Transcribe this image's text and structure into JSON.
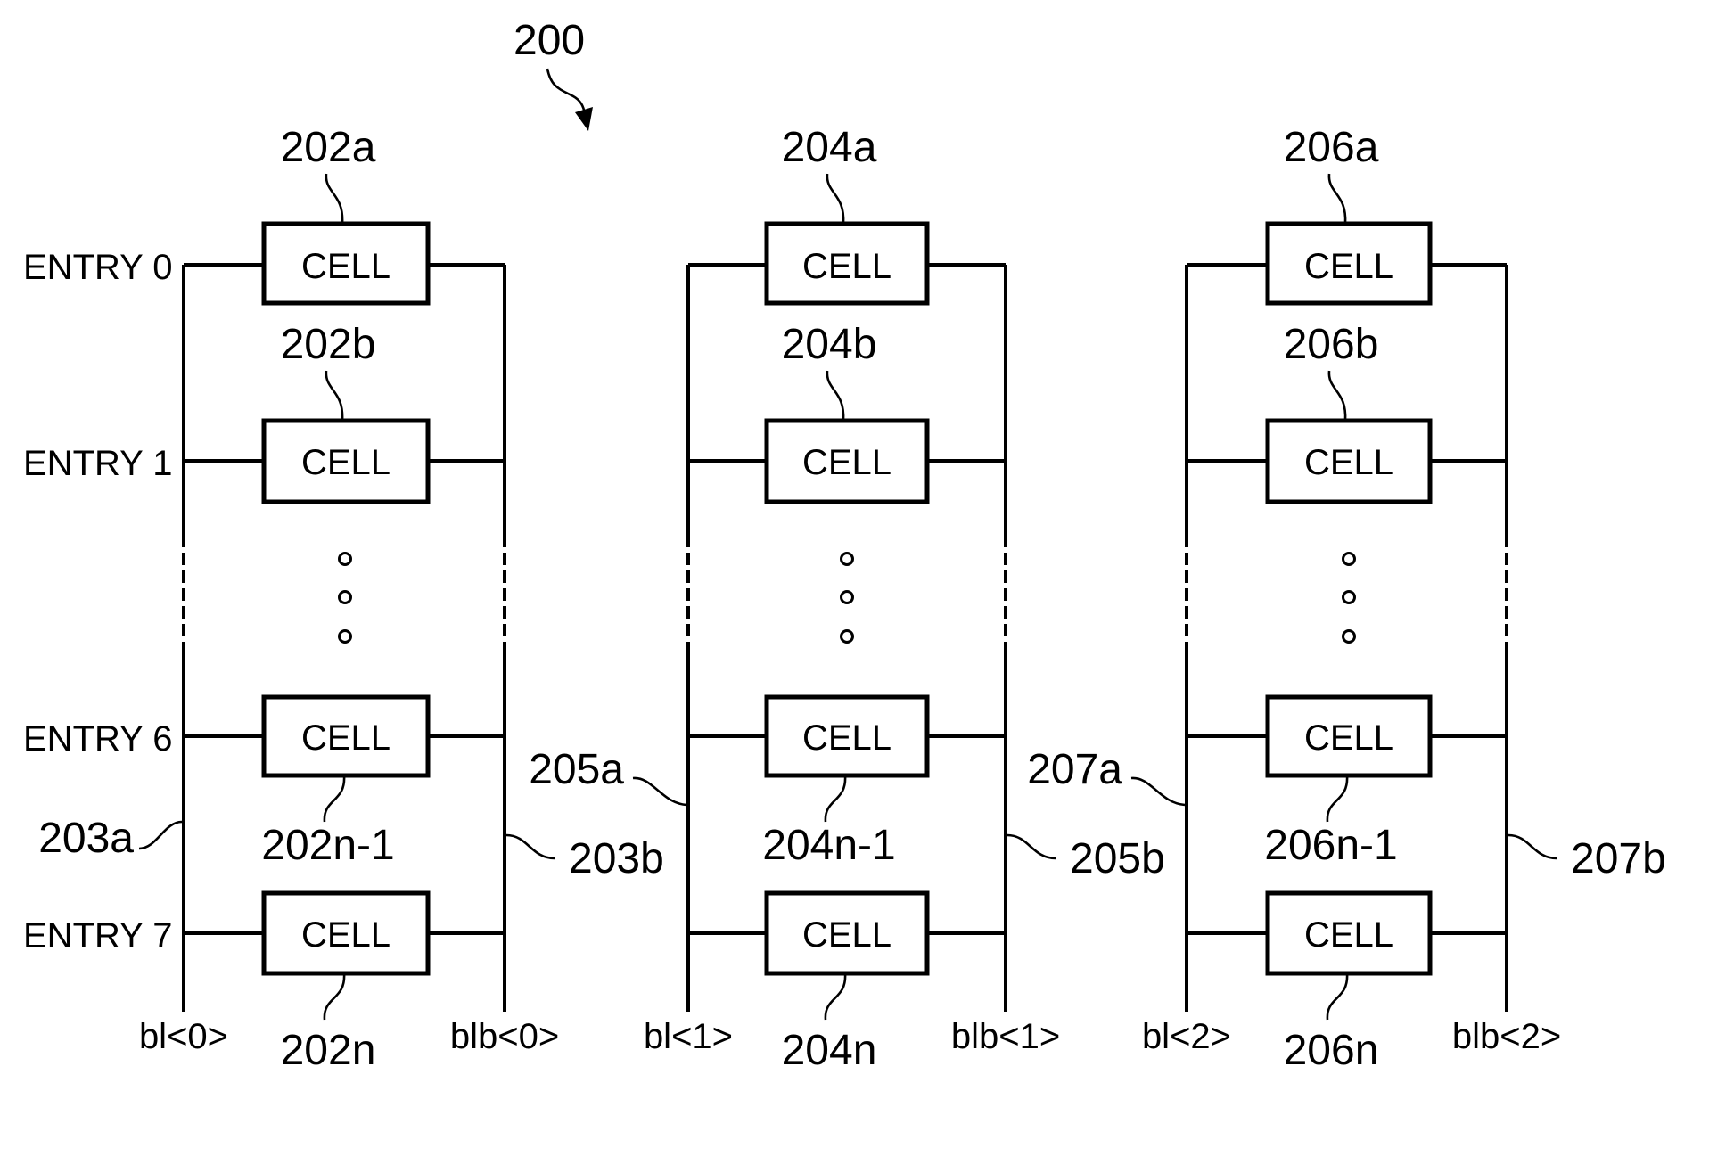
{
  "figure": {
    "reference": "200",
    "cell_label": "CELL"
  },
  "entries": [
    {
      "label": "ENTRY 0"
    },
    {
      "label": "ENTRY 1"
    },
    {
      "label": "ENTRY 6"
    },
    {
      "label": "ENTRY 7"
    }
  ],
  "columns": [
    {
      "bitline": "bl<0>",
      "bitline_bar": "blb<0>",
      "bitline_ref": "203a",
      "bitline_bar_ref": "203b",
      "cells": [
        "202a",
        "202b",
        "202n-1",
        "202n"
      ]
    },
    {
      "bitline": "bl<1>",
      "bitline_bar": "blb<1>",
      "bitline_ref": "205a",
      "bitline_bar_ref": "205b",
      "cells": [
        "204a",
        "204b",
        "204n-1",
        "204n"
      ]
    },
    {
      "bitline": "bl<2>",
      "bitline_bar": "blb<2>",
      "bitline_ref": "207a",
      "bitline_bar_ref": "207b",
      "cells": [
        "206a",
        "206b",
        "206n-1",
        "206n"
      ]
    }
  ]
}
